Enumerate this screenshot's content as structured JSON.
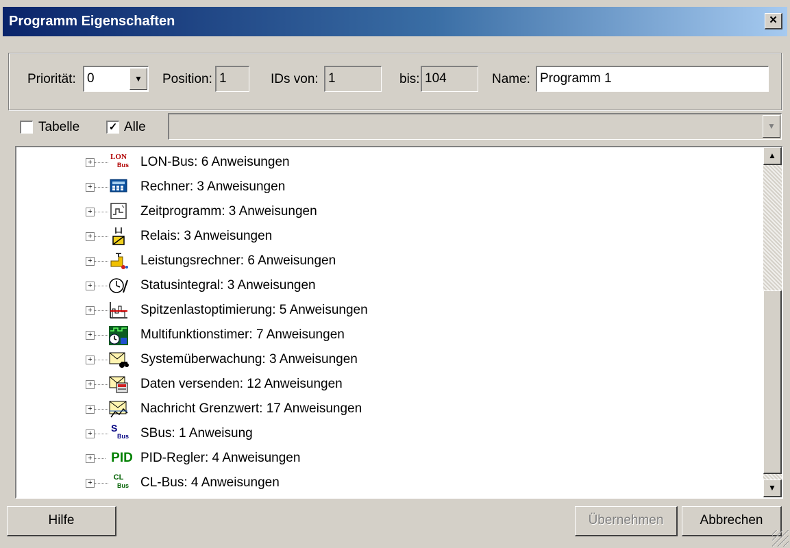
{
  "window": {
    "title": "Programm Eigenschaften",
    "close_label": "×"
  },
  "props": {
    "priority_label": "Priorität:",
    "priority_value": "0",
    "position_label": "Position:",
    "position_value": "1",
    "ids_from_label": "IDs von:",
    "ids_from_value": "1",
    "ids_to_label": "bis:",
    "ids_to_value": "104",
    "name_label": "Name:",
    "name_value": "Programm 1"
  },
  "filter": {
    "tabelle_label": "Tabelle",
    "tabelle_checked": false,
    "alle_label": "Alle",
    "alle_checked": true,
    "combo_value": ""
  },
  "tree": {
    "items": [
      {
        "label": "LON-Bus: 6 Anweisungen",
        "icon": "lon-bus-icon"
      },
      {
        "label": "Rechner: 3 Anweisungen",
        "icon": "calculator-icon"
      },
      {
        "label": "Zeitprogramm: 3 Anweisungen",
        "icon": "time-program-icon"
      },
      {
        "label": "Relais: 3 Anweisungen",
        "icon": "relay-icon"
      },
      {
        "label": "Leistungsrechner: 6 Anweisungen",
        "icon": "power-calculator-icon"
      },
      {
        "label": "Statusintegral: 3 Anweisungen",
        "icon": "status-integral-icon"
      },
      {
        "label": "Spitzenlastoptimierung: 5 Anweisungen",
        "icon": "peak-load-icon"
      },
      {
        "label": "Multifunktionstimer: 7 Anweisungen",
        "icon": "multifunction-timer-icon"
      },
      {
        "label": "Systemüberwachung: 3 Anweisungen",
        "icon": "system-monitor-icon"
      },
      {
        "label": "Daten versenden: 12 Anweisungen",
        "icon": "send-data-icon"
      },
      {
        "label": "Nachricht Grenzwert: 17 Anweisungen",
        "icon": "limit-message-icon"
      },
      {
        "label": "SBus: 1 Anweisung",
        "icon": "sbus-icon"
      },
      {
        "label": "PID-Regler: 4 Anweisungen",
        "icon": "pid-icon"
      },
      {
        "label": "CL-Bus: 4 Anweisungen",
        "icon": "cl-bus-icon"
      }
    ],
    "icon_text": {
      "lon_top": "LON",
      "lon_bottom": "Bus",
      "sbus_top": "S",
      "sbus_bottom": "Bus",
      "pid": "PID",
      "cl_top": "CL",
      "cl_bottom": "Bus"
    }
  },
  "buttons": {
    "help": "Hilfe",
    "apply": "Übernehmen",
    "cancel": "Abbrechen"
  }
}
